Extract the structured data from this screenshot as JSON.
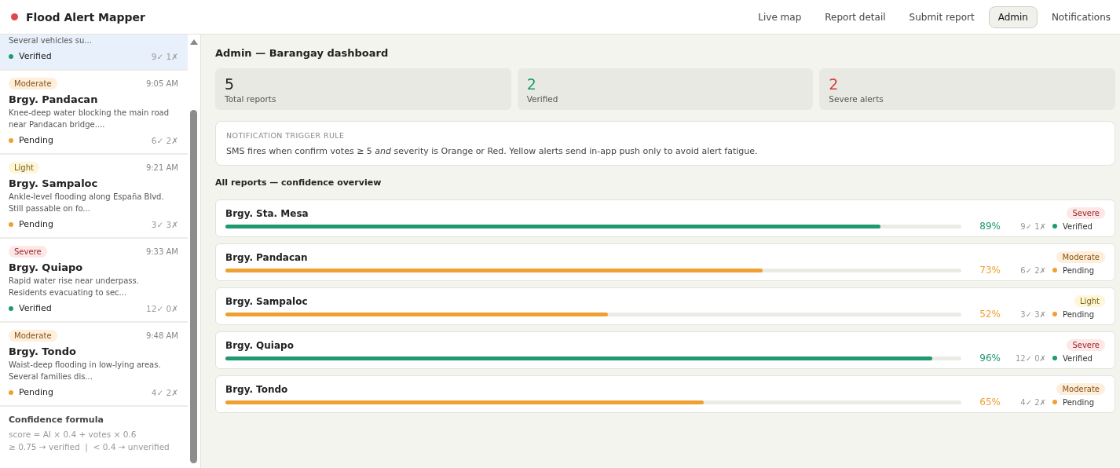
{
  "app": {
    "title": "Flood Alert Mapper"
  },
  "nav": [
    {
      "label": "Live map",
      "selected": false
    },
    {
      "label": "Report detail",
      "selected": false
    },
    {
      "label": "Submit report",
      "selected": false
    },
    {
      "label": "Admin",
      "selected": true
    },
    {
      "label": "Notifications",
      "selected": false
    }
  ],
  "sidebar": {
    "reports": [
      {
        "description": "Several vehicles su...",
        "status": {
          "label": "Verified",
          "kind": "verified"
        },
        "votes": "9✓ 1✗",
        "selected": true
      },
      {
        "severity": {
          "label": "Moderate",
          "kind": "moderate"
        },
        "time": "9:05 AM",
        "name": "Brgy. Pandacan",
        "description": "Knee-deep water blocking the main road near Pandacan bridge....",
        "status": {
          "label": "Pending",
          "kind": "pending"
        },
        "votes": "6✓ 2✗",
        "selected": false
      },
      {
        "severity": {
          "label": "Light",
          "kind": "light"
        },
        "time": "9:21 AM",
        "name": "Brgy. Sampaloc",
        "description": "Ankle-level flooding along España Blvd. Still passable on fo...",
        "status": {
          "label": "Pending",
          "kind": "pending"
        },
        "votes": "3✓ 3✗",
        "selected": false
      },
      {
        "severity": {
          "label": "Severe",
          "kind": "severe"
        },
        "time": "9:33 AM",
        "name": "Brgy. Quiapo",
        "description": "Rapid water rise near underpass. Residents evacuating to sec...",
        "status": {
          "label": "Verified",
          "kind": "verified"
        },
        "votes": "12✓ 0✗",
        "selected": false
      },
      {
        "severity": {
          "label": "Moderate",
          "kind": "moderate"
        },
        "time": "9:48 AM",
        "name": "Brgy. Tondo",
        "description": "Waist-deep flooding in low-lying areas. Several families dis...",
        "status": {
          "label": "Pending",
          "kind": "pending"
        },
        "votes": "4✓ 2✗",
        "selected": false
      }
    ],
    "formula": {
      "title": "Confidence formula",
      "lines": [
        "score = AI × 0.4 + votes × 0.6",
        "≥ 0.75 → verified  |  < 0.4 → unverified"
      ]
    }
  },
  "main": {
    "title": "Admin — Barangay dashboard",
    "stats": [
      {
        "value": "5",
        "label": "Total reports",
        "kind": "neutral"
      },
      {
        "value": "2",
        "label": "Verified",
        "kind": "good"
      },
      {
        "value": "2",
        "label": "Severe alerts",
        "kind": "bad"
      }
    ],
    "rule": {
      "heading": "NOTIFICATION TRIGGER RULE",
      "text": "SMS fires when confirm votes ≥ 5 *and* severity is Orange or Red. Yellow alerts send in-app push only to avoid alert fatigue."
    },
    "overview_title": "All reports — confidence overview",
    "reports": [
      {
        "name": "Brgy. Sta. Mesa",
        "severity": {
          "label": "Severe",
          "kind": "severe"
        },
        "level": 0.89,
        "percent": "89%",
        "votes": "9✓ 1✗",
        "status": {
          "label": "Verified",
          "kind": "verified"
        }
      },
      {
        "name": "Brgy. Pandacan",
        "severity": {
          "label": "Moderate",
          "kind": "moderate"
        },
        "level": 0.73,
        "percent": "73%",
        "votes": "6✓ 2✗",
        "status": {
          "label": "Pending",
          "kind": "pending"
        }
      },
      {
        "name": "Brgy. Sampaloc",
        "severity": {
          "label": "Light",
          "kind": "light"
        },
        "level": 0.52,
        "percent": "52%",
        "votes": "3✓ 3✗",
        "status": {
          "label": "Pending",
          "kind": "pending"
        }
      },
      {
        "name": "Brgy. Quiapo",
        "severity": {
          "label": "Severe",
          "kind": "severe"
        },
        "level": 0.96,
        "percent": "96%",
        "votes": "12✓ 0✗",
        "status": {
          "label": "Verified",
          "kind": "verified"
        }
      },
      {
        "name": "Brgy. Tondo",
        "severity": {
          "label": "Moderate",
          "kind": "moderate"
        },
        "level": 0.65,
        "percent": "65%",
        "votes": "4✓ 2✗",
        "status": {
          "label": "Pending",
          "kind": "pending"
        }
      }
    ]
  }
}
